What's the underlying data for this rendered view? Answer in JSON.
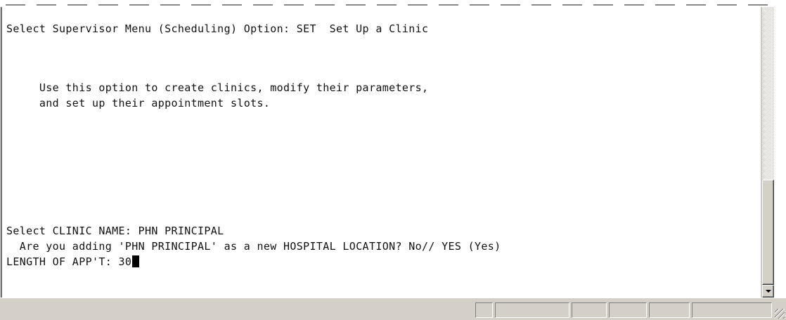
{
  "terminal": {
    "lines": [
      "Select Supervisor Menu (Scheduling) Option: SET  Set Up a Clinic",
      "     Use this option to create clinics, modify their parameters,",
      "     and set up their appointment slots.",
      "Select CLINIC NAME: PHN PRINCIPAL",
      "  Are you adding 'PHN PRINCIPAL' as a new HOSPITAL LOCATION? No// YES (Yes)",
      "LENGTH OF APP'T: 30"
    ]
  },
  "scrollbar": {
    "down_icon": "arrow-down-icon"
  },
  "statusbar": {
    "panels": [
      "",
      "",
      "",
      "",
      "",
      ""
    ],
    "grip_icon": "resize-grip-icon"
  }
}
